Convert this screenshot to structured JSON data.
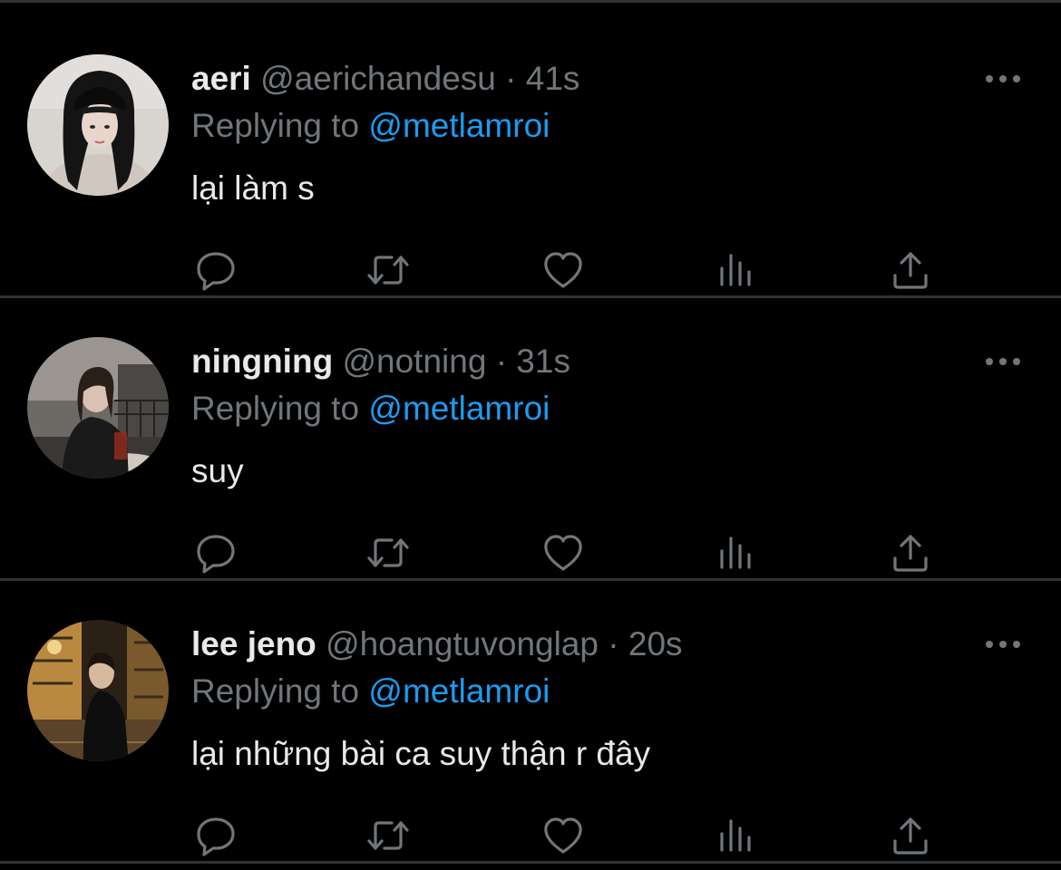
{
  "colors": {
    "background": "#000000",
    "divider": "#2f3336",
    "primary_text": "#e7e9ea",
    "secondary_text": "#71767b",
    "mention": "#1d9bf0"
  },
  "icons": {
    "reply": "reply-icon",
    "retweet": "retweet-icon",
    "like": "like-icon",
    "views": "views-icon",
    "share": "share-icon",
    "more": "more-icon"
  },
  "tweets": [
    {
      "name": "aeri",
      "handle": "@aerichandesu",
      "separator": "·",
      "time": "41s",
      "replying_prefix": "Replying to",
      "replying_to": "@metlamroi",
      "text": "lại làm s"
    },
    {
      "name": "ningning",
      "handle": "@notning",
      "separator": "·",
      "time": "31s",
      "replying_prefix": "Replying to",
      "replying_to": "@metlamroi",
      "text": "suy"
    },
    {
      "name": "lee jeno",
      "handle": "@hoangtuvonglap",
      "separator": "·",
      "time": "20s",
      "replying_prefix": "Replying to",
      "replying_to": "@metlamroi",
      "text": "lại những bài ca suy thận r đây"
    }
  ]
}
